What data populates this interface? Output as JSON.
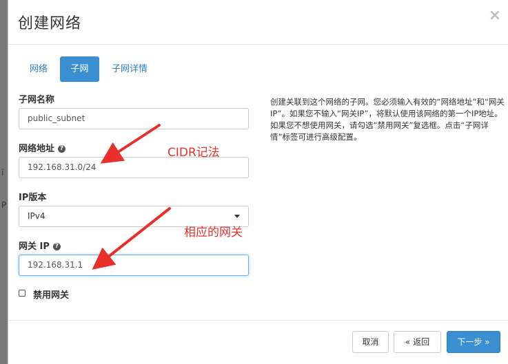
{
  "modal": {
    "title": "创建网络",
    "close": "×"
  },
  "tabs": [
    {
      "label": "网络",
      "active": false
    },
    {
      "label": "子网",
      "active": true
    },
    {
      "label": "子网详情",
      "active": false
    }
  ],
  "form": {
    "subnet_name": {
      "label": "子网名称",
      "value": "public_subnet"
    },
    "network_address": {
      "label": "网络地址",
      "value": "192.168.31.0/24"
    },
    "ip_version": {
      "label": "IP版本",
      "selected": "IPv4"
    },
    "gateway_ip": {
      "label": "网关 IP",
      "value": "192.168.31.1"
    },
    "disable_gateway": {
      "label": "禁用网关",
      "checked": false
    }
  },
  "help_text": "创建关联到这个网络的子网。您必须输入有效的“网络地址”和“网关 IP”。如果您不输入“网关IP”，将默认使用该网络的第一个IP地址。如果您不想使用网关，请勾选“禁用网关”复选框。点击“子网详情”标签可进行高级配置。",
  "annotations": {
    "cidr": "CIDR记法",
    "gateway": "相应的网关"
  },
  "buttons": {
    "cancel": "取消",
    "back": "« 返回",
    "next": "下一步 »"
  },
  "background_fragments": [
    "ï",
    "P"
  ],
  "colors": {
    "primary": "#3a8fd1",
    "annotation": "#e8302a",
    "link": "#2b7fc3"
  },
  "icons": {
    "close": "close-icon",
    "help": "help-icon",
    "select_caret": "caret-down-icon"
  }
}
